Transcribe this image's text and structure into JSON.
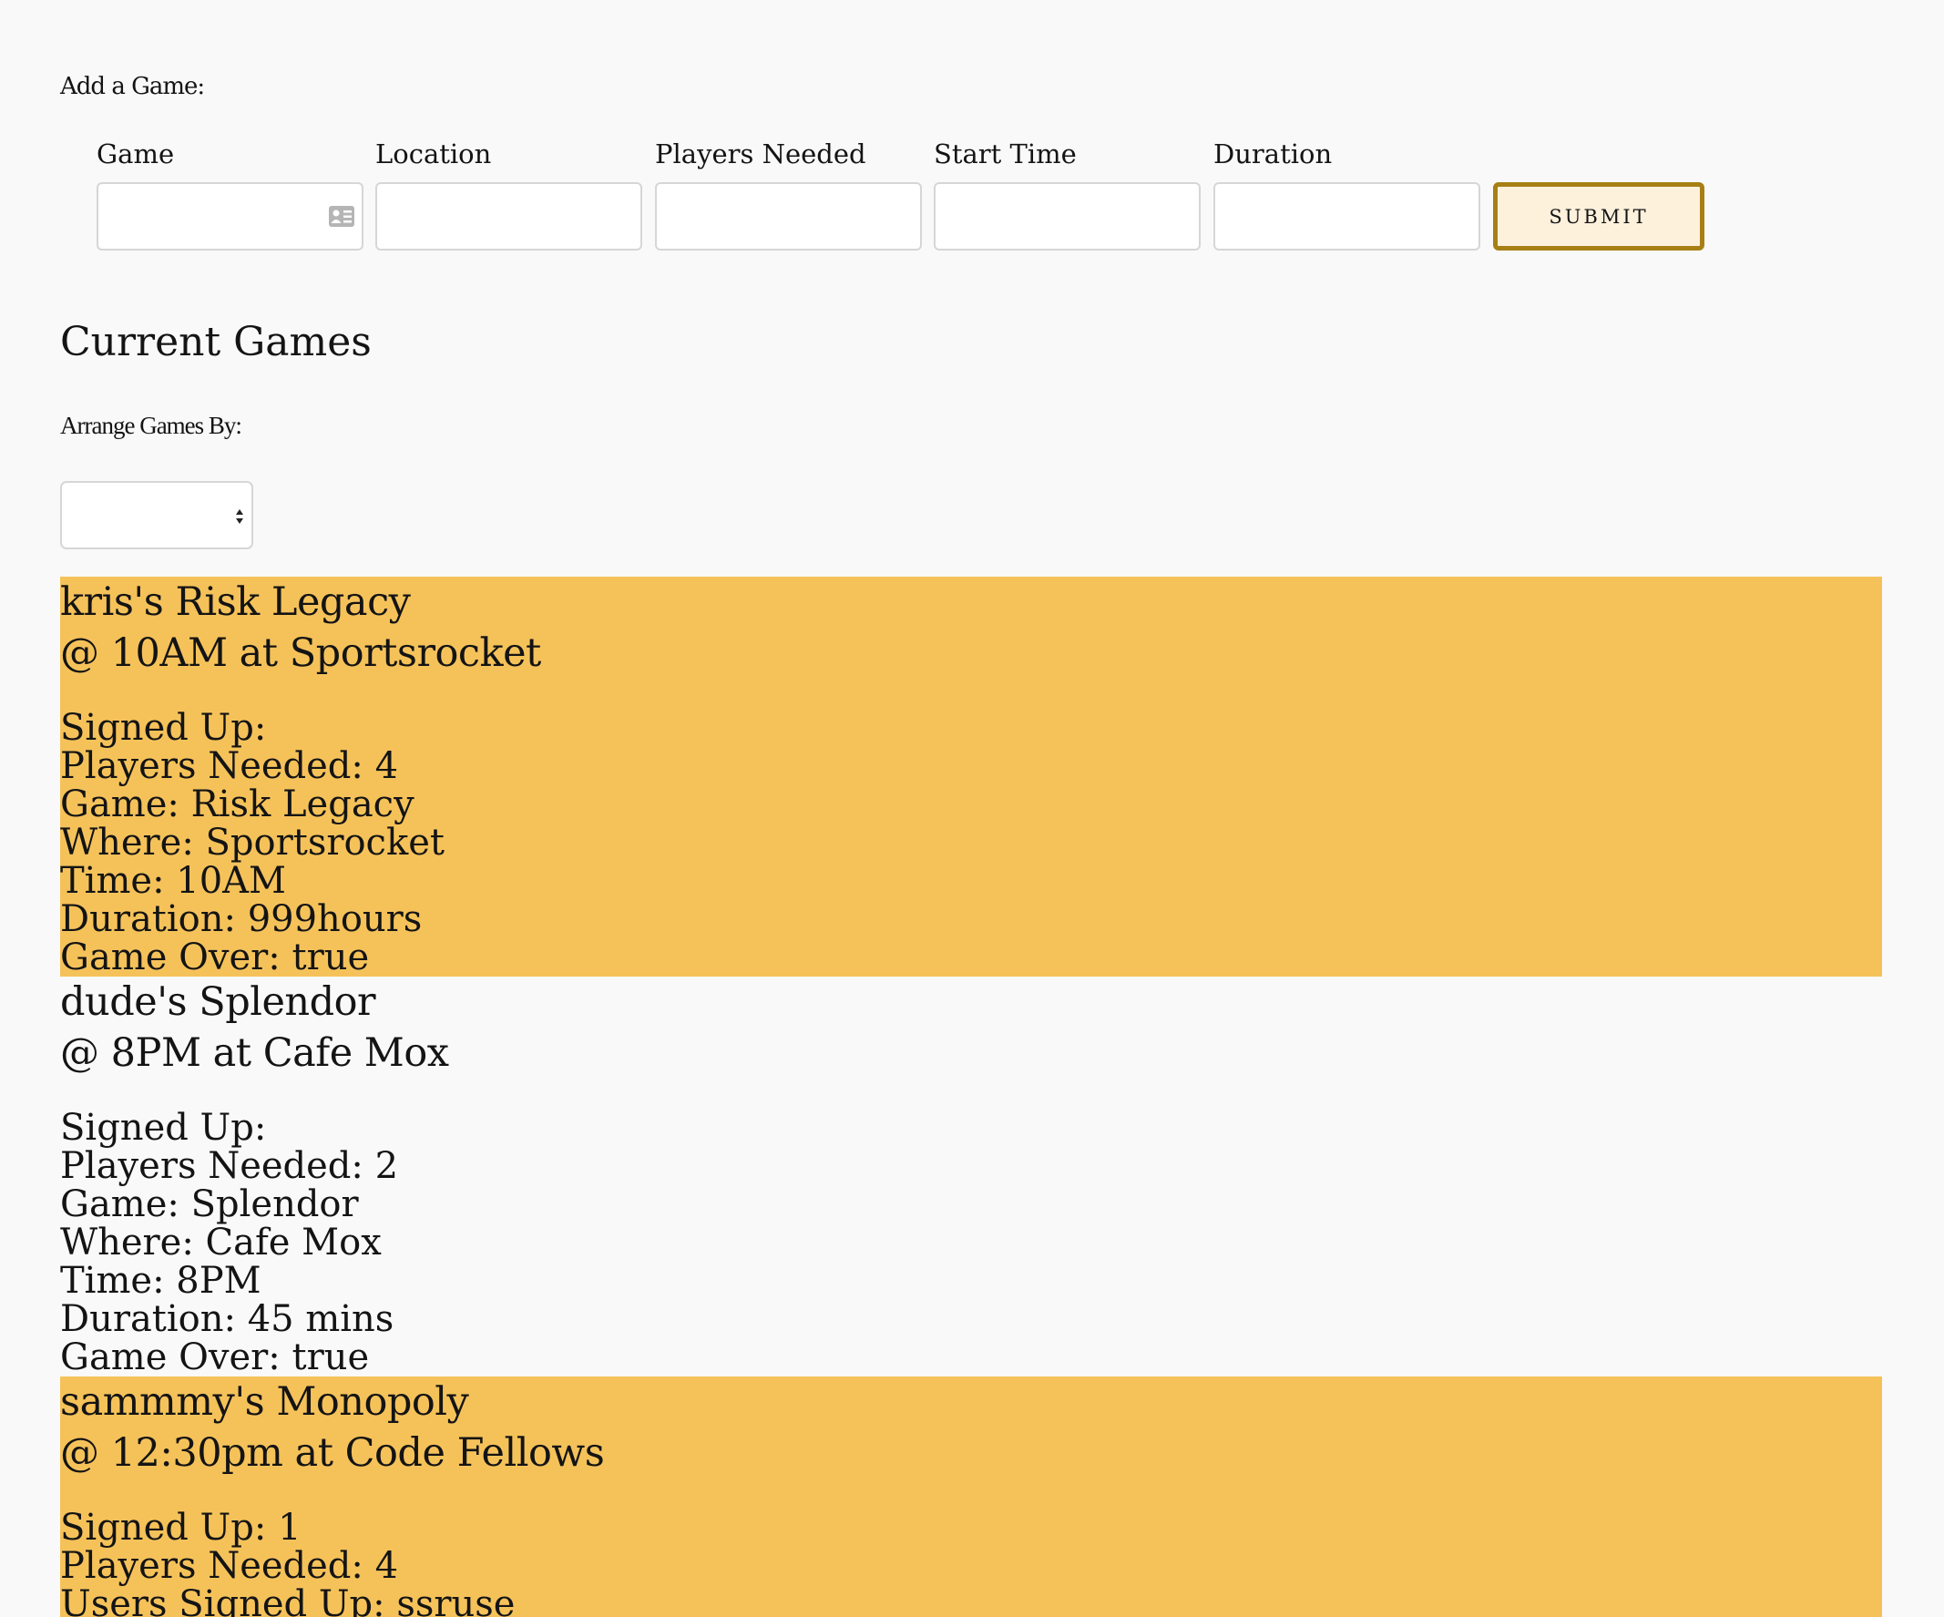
{
  "form": {
    "heading": "Add a Game:",
    "fields": [
      {
        "label": "Game",
        "value": "",
        "placeholder": ""
      },
      {
        "label": "Location",
        "value": "",
        "placeholder": ""
      },
      {
        "label": "Players Needed",
        "value": "",
        "placeholder": ""
      },
      {
        "label": "Start Time",
        "value": "",
        "placeholder": ""
      },
      {
        "label": "Duration",
        "value": "",
        "placeholder": ""
      }
    ],
    "submit_label": "SUBMIT",
    "game_field_icon": "contact-card-icon"
  },
  "current": {
    "title": "Current Games",
    "arrange_label": "Arrange Games By:",
    "sort_selected": "",
    "sort_icon": "select-arrows-icon"
  },
  "games": [
    {
      "title": "kris's Risk Legacy",
      "when_where": "@ 10AM at Sportsrocket",
      "signed_up": "Signed Up:",
      "players_needed": "Players Needed: 4",
      "game": "Game: Risk Legacy",
      "where": "Where: Sportsrocket",
      "time": "Time: 10AM",
      "duration": "Duration: 999hours",
      "game_over": "Game Over: true"
    },
    {
      "title": "dude's Splendor",
      "when_where": "@ 8PM at Cafe Mox",
      "signed_up": "Signed Up:",
      "players_needed": "Players Needed: 2",
      "game": "Game: Splendor",
      "where": "Where: Cafe Mox",
      "time": "Time: 8PM",
      "duration": "Duration: 45 mins",
      "game_over": "Game Over: true"
    },
    {
      "title": "sammmy's Monopoly",
      "when_where": "@ 12:30pm at Code Fellows",
      "signed_up": "Signed Up: 1",
      "players_needed": "Players Needed: 4",
      "users_signed_up": "Users Signed Up: ssruse"
    }
  ],
  "colors": {
    "page_background": "#f9f9f9",
    "card_highlight": "#f5c25a",
    "submit_border": "#a77f14",
    "submit_fill": "#fdf1dc",
    "input_border": "#d6d6d6",
    "text": "#141414"
  }
}
